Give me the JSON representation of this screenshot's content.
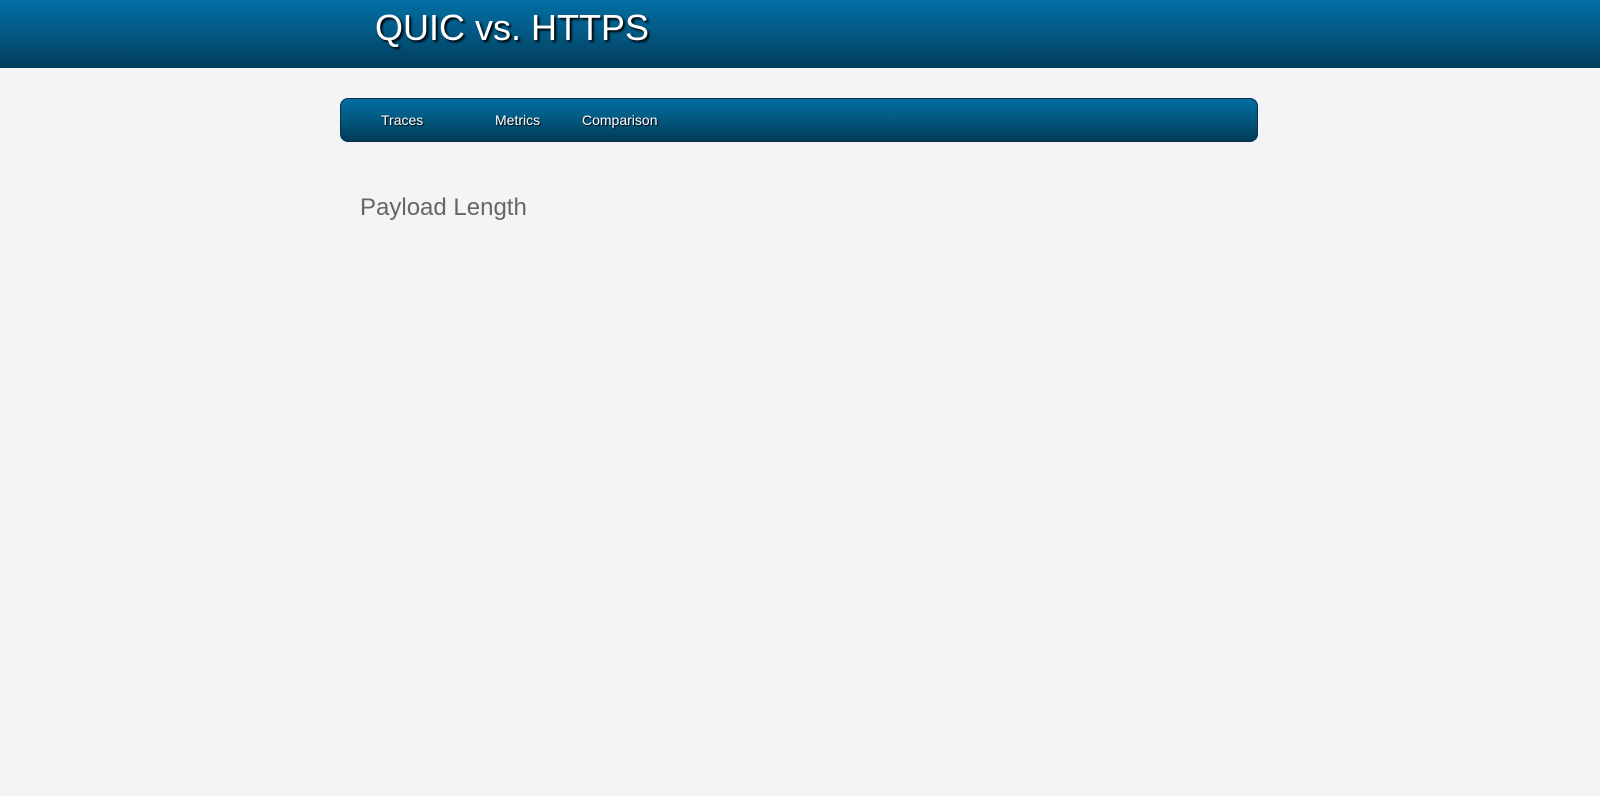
{
  "header": {
    "title": "QUIC vs. HTTPS"
  },
  "nav": {
    "items": [
      {
        "label": "Traces"
      },
      {
        "label": "Metrics"
      },
      {
        "label": "Comparison"
      }
    ]
  },
  "main": {
    "heading": "Payload Length"
  },
  "colors": {
    "header_gradient_top": "#016fa4",
    "header_gradient_bottom": "#013d5c",
    "page_background": "#f3f4f6",
    "heading_text": "#666666"
  }
}
